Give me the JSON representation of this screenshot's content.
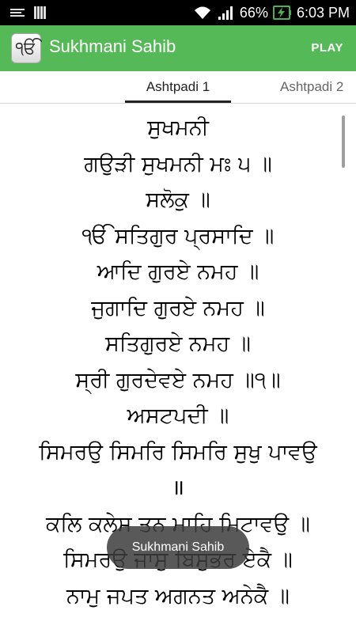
{
  "status_bar": {
    "battery_percent": "66%",
    "time": "6:03 PM",
    "icons": [
      "notification-icon",
      "signal-bars-icon",
      "wifi-icon",
      "cell-signal-icon",
      "battery-charging-icon"
    ]
  },
  "app_bar": {
    "icon_glyph": "ੴ",
    "title": "Sukhmani Sahib",
    "play_label": "PLAY"
  },
  "tabs": [
    {
      "label": "Ashtpadi 1"
    },
    {
      "label": "Ashtpadi 2"
    }
  ],
  "verses": [
    "ਸੁਖਮਨੀ",
    "ਗਉੜੀ ਸੁਖਮਨੀ ਮਃ ੫ ॥",
    "ਸਲੋਕੁ ॥",
    "ੴ ਸਤਿਗੁਰ ਪ੍ਰਸਾਦਿ ॥",
    "ਆਦਿ ਗੁਰਏ ਨਮਹ ॥",
    "ਜੁਗਾਦਿ ਗੁਰਏ ਨਮਹ ॥",
    "ਸਤਿਗੁਰਏ ਨਮਹ ॥",
    "ਸ੍ਰੀ ਗੁਰਦੇਵਏ ਨਮਹ ॥੧॥",
    "ਅਸਟਪਦੀ ॥",
    "ਸਿਮਰਉ ਸਿਮਰਿ ਸਿਮਰਿ ਸੁਖੁ ਪਾਵਉ",
    "॥",
    "ਕਲਿ ਕਲੇਸ ਤਨ ਮਾਹਿ ਮਿਟਾਵਉ ॥",
    "ਸਿਮਰਉ ਜਾਸੁ ਬਿਸੁੰਭਰ ਏਕੈ ॥",
    "ਨਾਮੁ ਜਪਤ ਅਗਨਤ ਅਨੇਕੈ ॥"
  ],
  "toast": {
    "text": "Sukhmani Sahib"
  },
  "colors": {
    "app_bar": "#55b957",
    "status_bar": "#000000",
    "battery_accent": "#4caf50",
    "text": "#000000"
  }
}
